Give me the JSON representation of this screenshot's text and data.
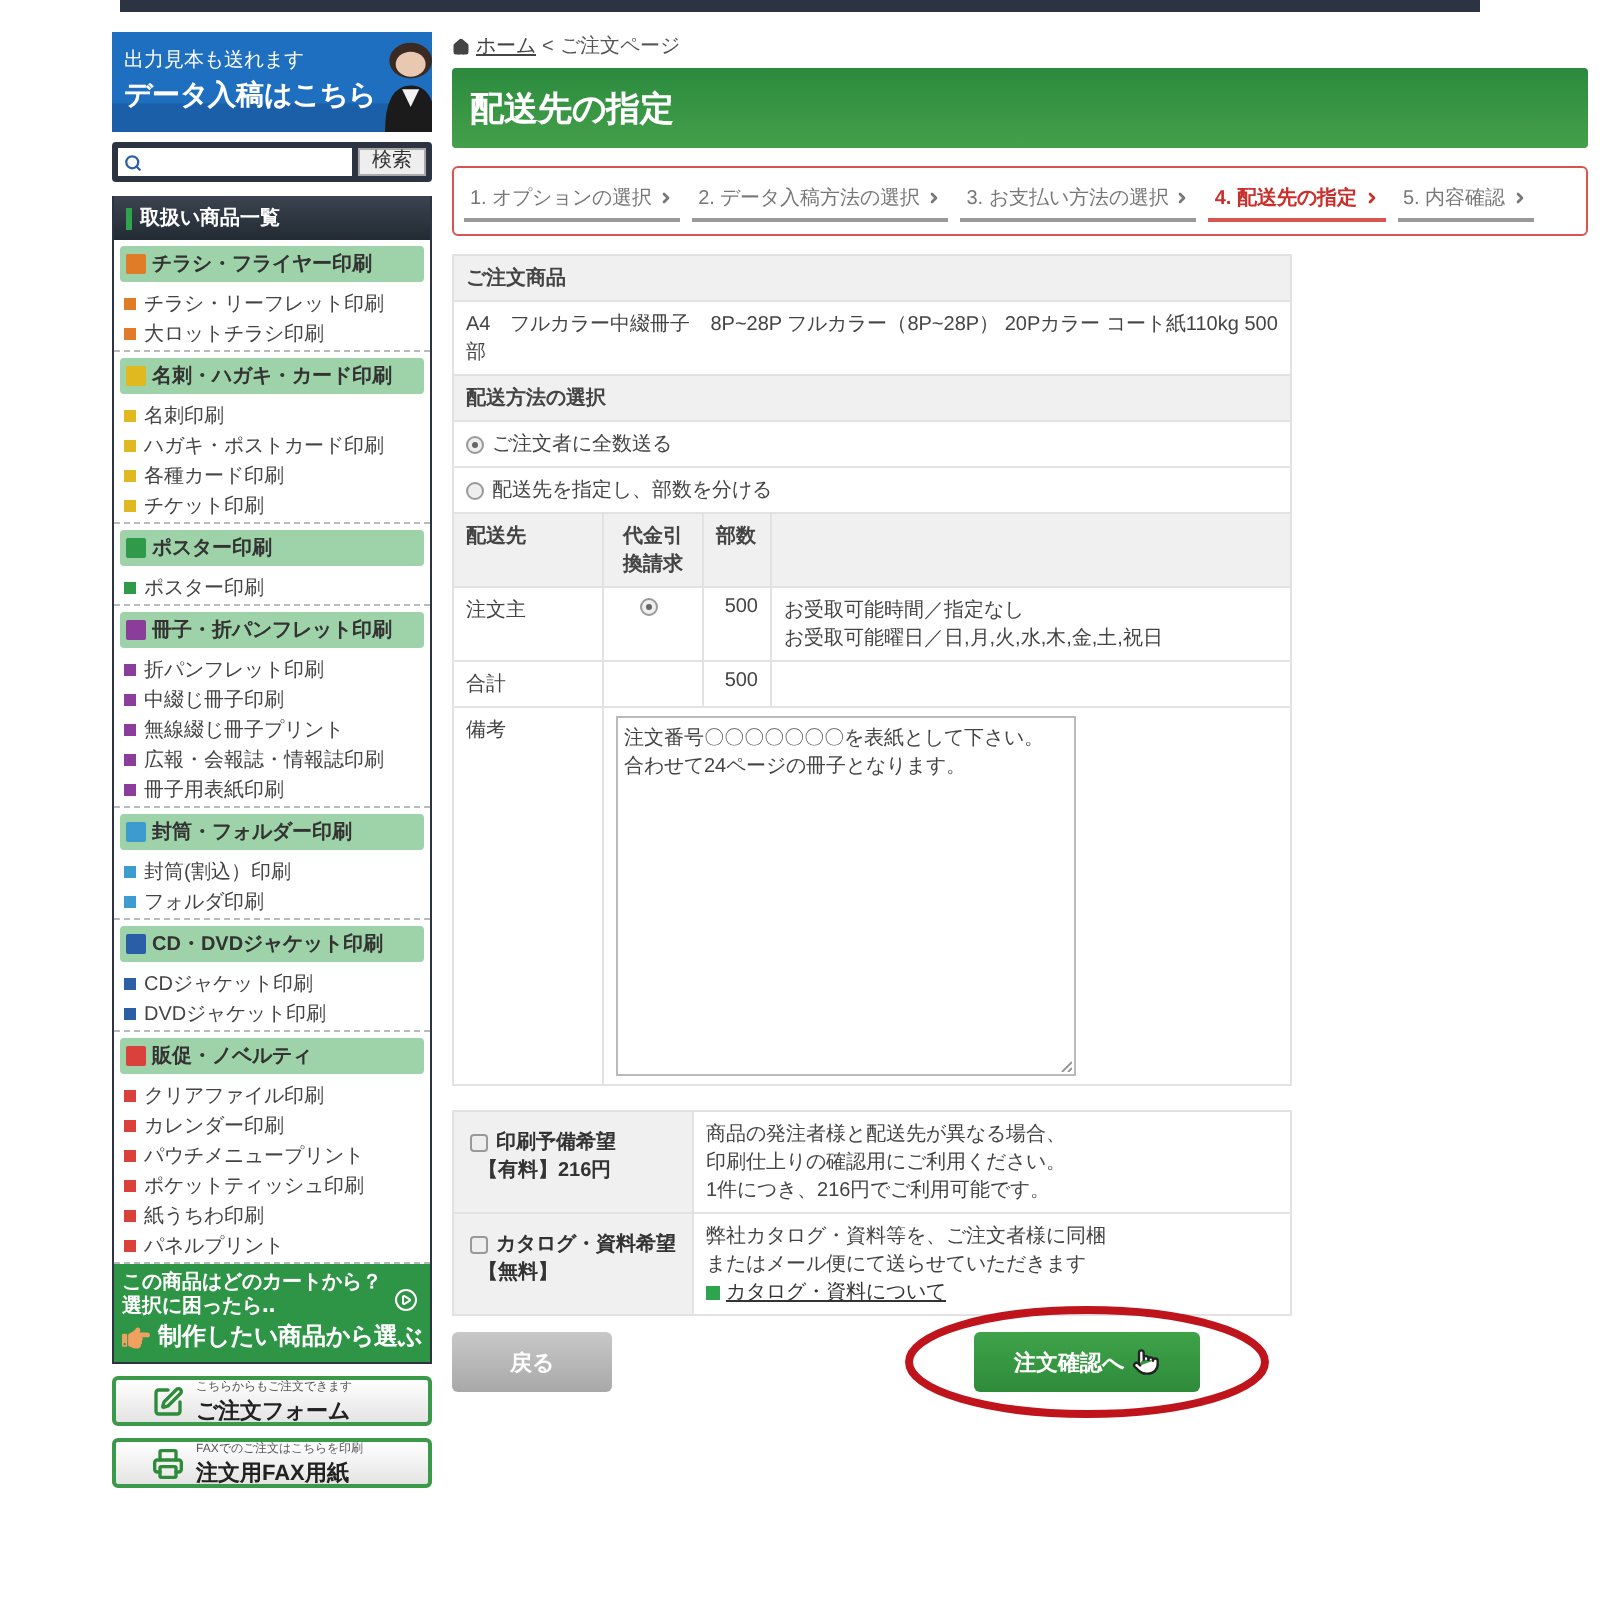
{
  "sidebar": {
    "banner": {
      "line1": "出力見本も送れます",
      "line2": "データ入稿はこちら"
    },
    "search": {
      "button": "検索"
    },
    "category_heading": "取扱い商品一覧",
    "categories": [
      {
        "title": "チラシ・フライヤー印刷",
        "color": "#e07b28",
        "items": [
          "チラシ・リーフレット印刷",
          "大ロットチラシ印刷"
        ]
      },
      {
        "title": "名刺・ハガキ・カード印刷",
        "color": "#e0b820",
        "items": [
          "名刺印刷",
          "ハガキ・ポストカード印刷",
          "各種カード印刷",
          "チケット印刷"
        ]
      },
      {
        "title": "ポスター印刷",
        "color": "#2f9a4a",
        "items": [
          "ポスター印刷"
        ]
      },
      {
        "title": "冊子・折パンフレット印刷",
        "color": "#8a3d9a",
        "items": [
          "折パンフレット印刷",
          "中綴じ冊子印刷",
          "無線綴じ冊子プリント",
          "広報・会報誌・情報誌印刷",
          "冊子用表紙印刷"
        ]
      },
      {
        "title": "封筒・フォルダー印刷",
        "color": "#3d9bd0",
        "items": [
          "封筒(割込）印刷",
          "フォルダ印刷"
        ]
      },
      {
        "title": "CD・DVDジャケット印刷",
        "color": "#2a5fa8",
        "items": [
          "CDジャケット印刷",
          "DVDジャケット印刷"
        ]
      },
      {
        "title": "販促・ノベルティ",
        "color": "#d9413a",
        "items": [
          "クリアファイル印刷",
          "カレンダー印刷",
          "パウチメニュープリント",
          "ポケットティッシュ印刷",
          "紙うちわ印刷",
          "パネルプリント"
        ]
      }
    ],
    "guide": {
      "line1": "この商品はどのカートから？",
      "line2": "選択に困ったら‥",
      "link": "制作したい商品から選ぶ"
    },
    "order_buttons": [
      {
        "kind": "form",
        "caption": "こちらからもご注文できます",
        "label": "ご注文フォーム"
      },
      {
        "kind": "fax",
        "caption": "FAXでのご注文はこちらを印刷",
        "label": "注文用FAX用紙"
      }
    ]
  },
  "breadcrumb": {
    "home": "ホーム",
    "separator": "<",
    "current": "ご注文ページ"
  },
  "page_title": "配送先の指定",
  "steps": [
    {
      "label": "1. オプションの選択",
      "selected": false
    },
    {
      "label": "2. データ入稿方法の選択",
      "selected": false
    },
    {
      "label": "3. お支払い方法の選択",
      "selected": false
    },
    {
      "label": "4. 配送先の指定",
      "selected": true
    },
    {
      "label": "5. 内容確認",
      "selected": false
    }
  ],
  "order": {
    "product_heading": "ご注文商品",
    "product": "A4　フルカラー中綴冊子　8P~28P フルカラー（8P~28P） 20Pカラー コート紙110kg 500部",
    "shipping_heading": "配送方法の選択",
    "shipping_options": [
      {
        "label": "ご注文者に全数送る",
        "selected": true
      },
      {
        "label": "配送先を指定し、部数を分ける",
        "selected": false
      }
    ],
    "columns": [
      "配送先",
      "代金引換請求",
      "部数"
    ],
    "rows": [
      {
        "destination": "注文主",
        "cod_selected": true,
        "copies": "500",
        "notes": [
          "お受取可能時間／指定なし",
          "お受取可能曜日／日,月,火,水,木,金,土,祝日"
        ]
      }
    ],
    "total": {
      "label": "合計",
      "copies": "500"
    },
    "remarks": {
      "label": "備考",
      "lines": [
        "注文番号〇〇〇〇〇〇〇を表紙として下さい。",
        "合わせて24ページの冊子となります。"
      ]
    }
  },
  "extras": [
    {
      "title": "印刷予備希望",
      "price": "【有料】216円",
      "checked": false,
      "description": [
        "商品の発注者様と配送先が異なる場合、",
        "印刷仕上りの確認用にご利用ください。",
        "1件につき、216円でご利用可能です。"
      ]
    },
    {
      "title": "カタログ・資料希望",
      "price": "【無料】",
      "checked": false,
      "description": [
        "弊社カタログ・資料等を、ご注文者様に同梱",
        "またはメール便にて送らせていただきます"
      ],
      "link": "カタログ・資料について"
    }
  ],
  "buttons": [
    {
      "kind": "back",
      "label": "戻る",
      "highlighted": false
    },
    {
      "kind": "next",
      "label": "注文確認へ",
      "highlighted": true
    }
  ]
}
